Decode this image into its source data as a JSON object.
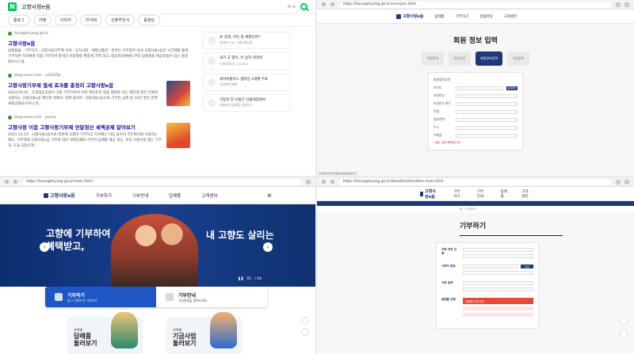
{
  "q1": {
    "chrome": {
      "url": ""
    },
    "search": {
      "query": "고향사랑e음",
      "tools": "✉ ≡"
    },
    "tabs": [
      "통로그",
      "카페",
      "이미지",
      "지식iN",
      "인플루언서",
      "동영상"
    ],
    "results": [
      {
        "source": "ilovegohyang.go.kr",
        "title": "고향사랑e음",
        "desc": "답례품몰 · 기부하기 · 고향사랑기부제 안내 · 공지사항 · 체험식품관 · 온라인 기부참여 안내 고향사랑e음은 시간제를 통해 기부하면 지자체에 직접 기부하며 많지만 지방재정 확충에 기여 하고, 대상지자체에도부터 답례품을 제공받을수 있는 종합정보시스템"
      },
      {
        "source": "blog.naver.com · se0125b",
        "title": "고향사랑기부제 절세 효과를 총정리 고향사랑e음",
        "desc": "2023.05.05 · 도정협동조합이 고향 기부하면서 하면 여러분의 많을 쌤대로 하는 예전에 많은 분께서 사랑하는 고향사랑e음 제도에 대해서, 함께 돌아본. 고향사랑e음으로 기부한 금액 중 10만 원은 전액 세액공제되므로니 즉..."
      },
      {
        "source": "blog.naver.com · joyma",
        "title": "고향사랑 이음 고향사랑기부제 연말정산 세액공제 알아보기",
        "desc": "2023.12.19 · 고향사랑e음이와 레몬에 고향이 기부하고 지자체는 이음 들어서 주민복리에 사용하는 제도. 기부액에 고향사랑e음 기부에 대한 세액공제와 기부한 답례를 제공 경신, 포밍 고향사랑 했는 기부자, 도움 되었으면..."
      }
    ],
    "side": [
      {
        "title": "AI 검색, 이득 뭔 써봤다면?",
        "sub": "네이버 Cue: 고향사랑e음"
      },
      {
        "title": "내가 고 향이, 이 탕자 쉬워워",
        "sub": "고향사랑e음, CASH 4"
      },
      {
        "title": "네이버플러스 멤버십 3개월 무료",
        "sub": "가입하면 혜택"
      },
      {
        "title": "가장의 달 선물은 산물대접에서",
        "sub": "고향사랑 답례품 선물하기"
      }
    ]
  },
  "q2": {
    "chrome": {
      "url": "https://ilovegohyang.go.kr/user/join.html"
    },
    "nav": {
      "logo": "고향사랑e음",
      "items": [
        "답례품",
        "기부하기",
        "알림마당",
        "고객센터"
      ]
    },
    "title": "회원 정보 입력",
    "steps": [
      "약관동의",
      "본인인증",
      "회원정보입력",
      "가입완료"
    ],
    "form": {
      "labels": [
        "회원정보입력",
        "아이디",
        "비밀번호",
        "비밀번호 확인",
        "이름",
        "휴대전화",
        "주소",
        "이메일"
      ],
      "btn": "중복확인",
      "note": "* 필수 입력 항목입니다"
    },
    "status": "https://ilovegohyang.go.kr"
  },
  "q3": {
    "chrome": {
      "url": "https://ilovegohyang.go.kr/main.html"
    },
    "nav": {
      "logo": "고향사랑e음",
      "items": [
        "기부하기",
        "기부안내",
        "답례품",
        "고객센터"
      ],
      "menu": "≡"
    },
    "hero": {
      "left": "고향에 기부하여\n혜택받고,",
      "right": "내 고향도 살리는",
      "counter_cur": "01",
      "counter_total": "/ 04",
      "prev": "‹",
      "next": "›"
    },
    "quick": [
      {
        "title": "기부하기",
        "sub": "쉽고 간편하게 기부하기"
      },
      {
        "title": "기부안내",
        "sub": "기부방법을 알려드려요"
      }
    ],
    "cards": [
      {
        "small": "지역별",
        "big": "답례품\n둘러보기"
      },
      {
        "small": "지역별",
        "big": "기금사업\n둘러보기"
      }
    ]
  },
  "q4": {
    "chrome": {
      "url": "https://ilovegohyang.go.kr/donation/donation-main.html"
    },
    "nav": {
      "logo": "고향사랑e음",
      "items": [
        "기부하기",
        "기부안내",
        "답례품",
        "고객센터"
      ]
    },
    "crumb": "홈 > 기부하기",
    "title": "기부하기",
    "sections": [
      {
        "label": "기부 지역 선택"
      },
      {
        "label": "기부자 정보"
      },
      {
        "label": "기부 금액"
      },
      {
        "label": "답례품 선택"
      }
    ],
    "btn": "검색",
    "alert": "답례품 선택 안내"
  },
  "colors": {
    "naver_green": "#03c75a",
    "brand_navy": "#1c3a7a",
    "hero_blue": "#1a3f8e",
    "cta_blue": "#1e56c4",
    "alert_red": "#e8483a"
  }
}
